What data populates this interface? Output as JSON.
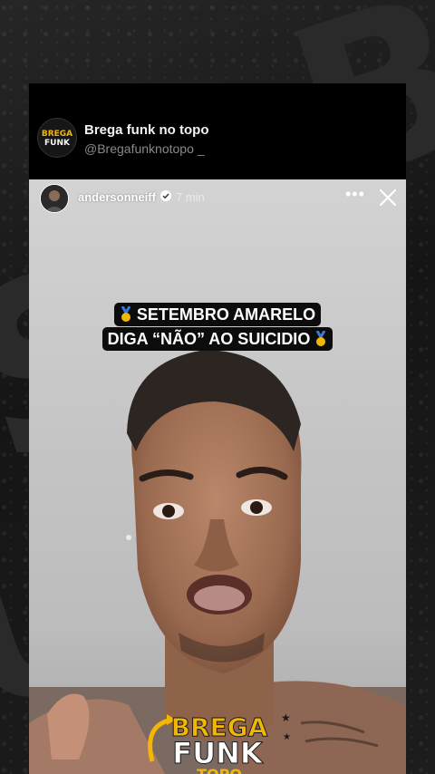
{
  "channel": {
    "name": "Brega funk no topo",
    "handle": "@Bregafunknotopo _",
    "avatar_text": [
      "BREGA",
      "FUNK"
    ]
  },
  "story": {
    "username": "andersonneiff",
    "time": "7 min",
    "caption_line1": "SETEMBRO AMARELO",
    "caption_line2": "DIGA “NÃO” AO SUICIDIO"
  },
  "overlay_logo": {
    "line1": "BREGA",
    "line2": "FUNK",
    "line3": "TOPO"
  },
  "icons": {
    "verified": "verified-badge-icon",
    "more": "more-options-icon",
    "close": "close-icon",
    "medal": "gold-medal-icon"
  },
  "colors": {
    "background": "#141414",
    "card": "#000000",
    "caption_bg": "#0c0c0c",
    "logo_gold": "#f2b705"
  }
}
